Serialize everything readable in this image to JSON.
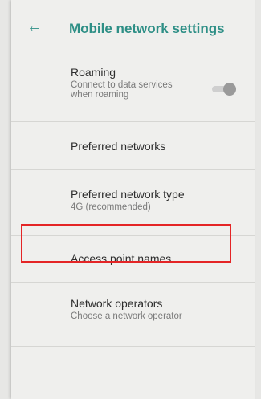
{
  "header": {
    "back_icon": "arrow-back-icon",
    "title": "Mobile network settings"
  },
  "settings": [
    {
      "title": "Roaming",
      "subtitle": "Connect to data services\nwhen roaming",
      "toggle": {
        "state": "off"
      }
    },
    {
      "title": "Preferred networks",
      "subtitle": ""
    },
    {
      "title": "Preferred network type",
      "subtitle": "4G (recommended)"
    },
    {
      "title": "Access point names",
      "subtitle": "",
      "highlighted": true,
      "highlight_color": "#e42526"
    },
    {
      "title": "Network operators",
      "subtitle": "Choose a network operator"
    }
  ],
  "colors": {
    "accent": "#2e8f86",
    "background": "#efefed"
  }
}
